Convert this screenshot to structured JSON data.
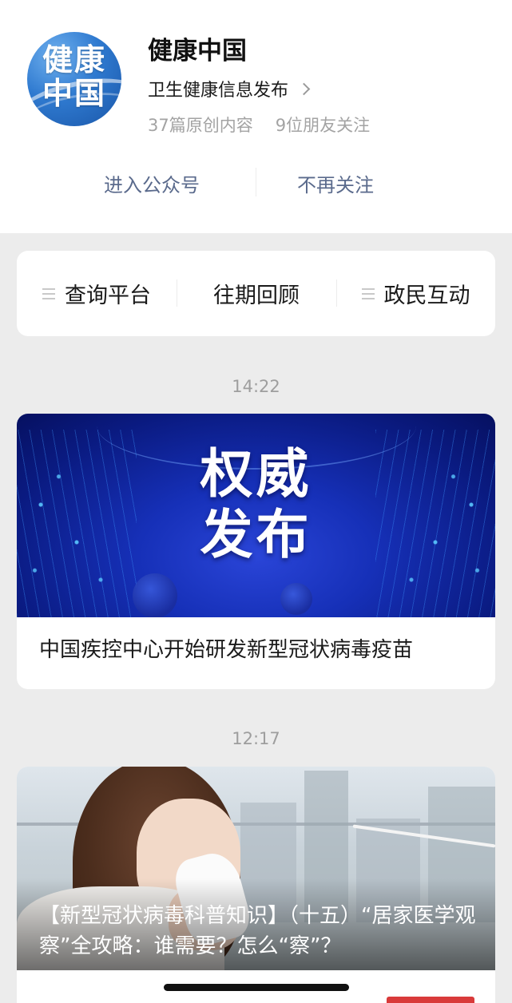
{
  "profile": {
    "avatar_text": "健康\n中国",
    "name": "健康中国",
    "description": "卫生健康信息发布",
    "stats": {
      "original_count": "37篇原创内容",
      "friends_following": "9位朋友关注"
    },
    "actions": {
      "enter": "进入公众号",
      "unfollow": "不再关注"
    }
  },
  "menu": {
    "items": [
      {
        "label": "查询平台",
        "has_submenu": true
      },
      {
        "label": "往期回顾",
        "has_submenu": false
      },
      {
        "label": "政民互动",
        "has_submenu": true
      }
    ]
  },
  "feed": [
    {
      "time": "14:22",
      "banner_text": "权威\n发布",
      "title": "中国疾控中心开始研发新型冠状病毒疫苗"
    },
    {
      "time": "12:17",
      "title": "【新型冠状病毒科普知识】（十五）“居家医学观察”全攻略：谁需要？怎么“察”？"
    }
  ],
  "colors": {
    "background": "#ececec",
    "card": "#ffffff",
    "action_text": "#5a6a8c",
    "muted_text": "#a3a3a3",
    "avatar_blue": "#2f7ad0",
    "banner_blue": "#1630b8"
  }
}
